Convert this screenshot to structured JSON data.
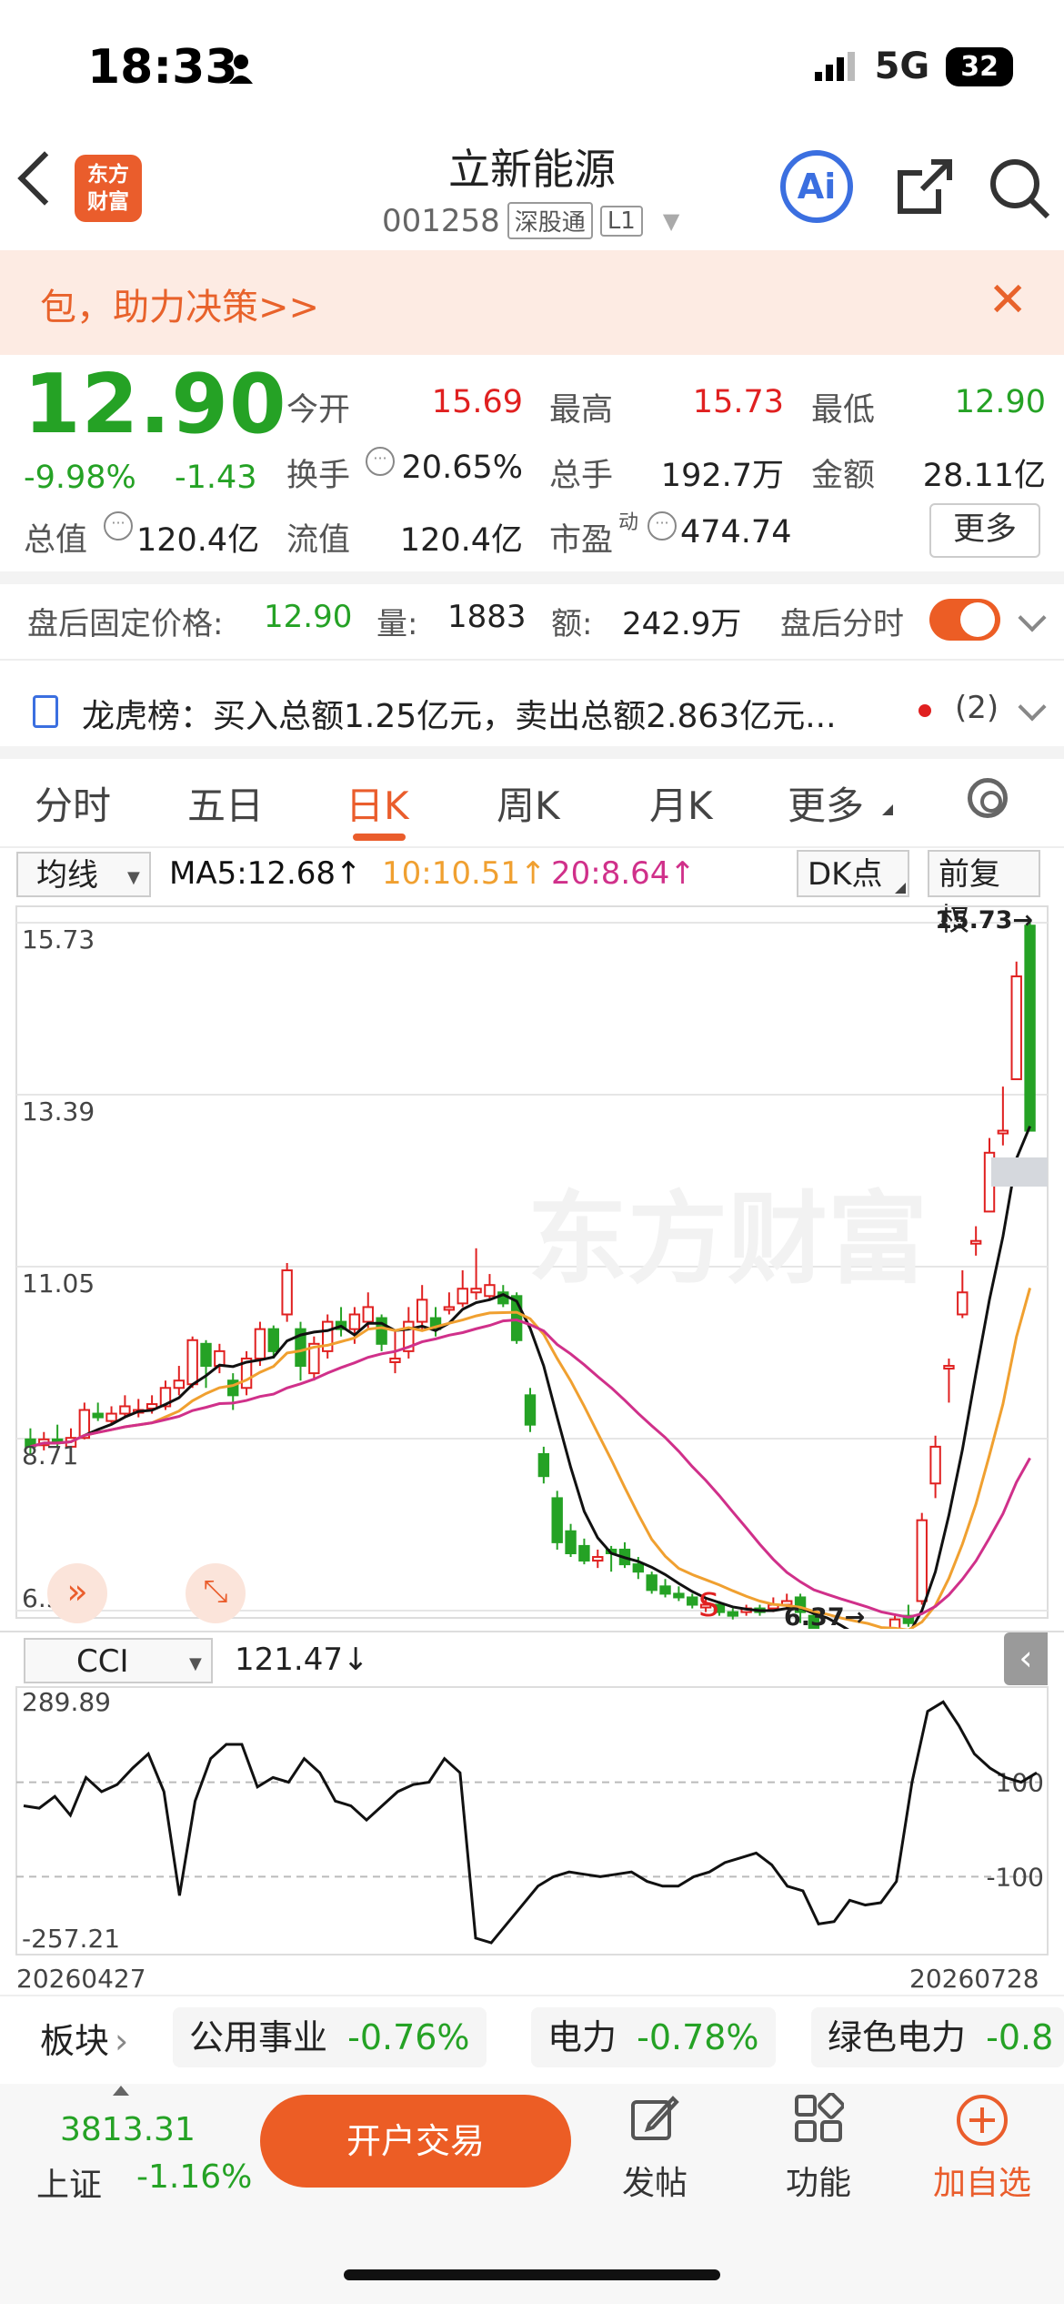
{
  "status_bar": {
    "time": "18:33",
    "network": "5G",
    "battery": "32"
  },
  "header": {
    "title": "立新能源",
    "code": "001258",
    "tag1": "深股通",
    "tag2": "L1",
    "logo_line1": "东方",
    "logo_line2": "财富",
    "ai_label": "Ai"
  },
  "banner": {
    "text": "包，助力决策>>"
  },
  "quote": {
    "price": "12.90",
    "change_pct": "-9.98%",
    "change": "-1.43",
    "open_label": "今开",
    "open": "15.69",
    "high_label": "最高",
    "high": "15.73",
    "low_label": "最低",
    "low": "12.90",
    "turnover_label": "换手",
    "turnover": "20.65%",
    "volume_label": "总手",
    "volume": "192.7万",
    "amount_label": "金额",
    "amount": "28.11亿",
    "mktcap_label": "总值",
    "mktcap": "120.4亿",
    "float_label": "流值",
    "float_cap": "120.4亿",
    "pe_label": "市盈",
    "pe_sup": "动",
    "pe": "474.74",
    "more": "更多"
  },
  "after_hours": {
    "label": "盘后固定价格:",
    "price": "12.90",
    "vol_label": "量:",
    "vol": "1883",
    "amt_label": "额:",
    "amt": "242.9万",
    "timeshare": "盘后分时"
  },
  "dragon_tiger": {
    "text": "龙虎榜：买入总额1.25亿元，卖出总额2.863亿元...",
    "count": "(2)"
  },
  "tabs": [
    "分时",
    "五日",
    "日K",
    "周K",
    "月K",
    "更多"
  ],
  "chart_controls": {
    "ma_select": "均线",
    "ma5": "MA5:12.68↑",
    "ma10": "10:10.51↑",
    "ma20": "20:8.64↑",
    "dk": "DK点",
    "adjust": "前复权"
  },
  "indicator": {
    "name": "CCI",
    "value": "121.47↓"
  },
  "colors": {
    "up": "#e02020",
    "down": "#25a225",
    "accent": "#ea5d2c",
    "ma5": "#111111",
    "ma10": "#f0a030",
    "ma20": "#d0308a"
  },
  "chart_data": {
    "type": "candlestick",
    "y_ticks": [
      "15.73",
      "13.39",
      "11.05",
      "8.71",
      "6.37"
    ],
    "ylim": [
      6.37,
      15.73
    ],
    "annotations": {
      "max_label": "15.73→",
      "min_label": "6.37→",
      "marker": "S"
    },
    "x_start": "20260427",
    "x_end": "20260728",
    "candles": [
      [
        8.7,
        8.6,
        8.85,
        8.5
      ],
      [
        8.62,
        8.7,
        8.8,
        8.55
      ],
      [
        8.7,
        8.65,
        8.9,
        8.6
      ],
      [
        8.6,
        8.72,
        8.85,
        8.55
      ],
      [
        8.72,
        9.1,
        9.2,
        8.7
      ],
      [
        9.05,
        9.0,
        9.2,
        8.95
      ],
      [
        8.95,
        9.05,
        9.15,
        8.9
      ],
      [
        9.05,
        9.15,
        9.3,
        9.0
      ],
      [
        9.1,
        9.1,
        9.25,
        9.0
      ],
      [
        9.12,
        9.18,
        9.3,
        9.05
      ],
      [
        9.15,
        9.4,
        9.5,
        9.1
      ],
      [
        9.4,
        9.5,
        9.7,
        9.3
      ],
      [
        9.45,
        10.05,
        10.1,
        9.4
      ],
      [
        10.0,
        9.7,
        10.05,
        9.4
      ],
      [
        9.7,
        9.9,
        10.0,
        9.6
      ],
      [
        9.5,
        9.3,
        9.6,
        9.1
      ],
      [
        9.4,
        9.8,
        9.9,
        9.3
      ],
      [
        9.8,
        10.2,
        10.3,
        9.7
      ],
      [
        10.2,
        9.9,
        10.25,
        9.8
      ],
      [
        10.4,
        11.0,
        11.1,
        10.3
      ],
      [
        10.2,
        9.7,
        10.3,
        9.5
      ],
      [
        9.6,
        10.0,
        10.1,
        9.5
      ],
      [
        9.9,
        10.3,
        10.4,
        9.8
      ],
      [
        10.3,
        10.2,
        10.5,
        10.1
      ],
      [
        10.2,
        10.4,
        10.5,
        10.0
      ],
      [
        10.3,
        10.5,
        10.7,
        10.2
      ],
      [
        10.35,
        10.0,
        10.4,
        9.9
      ],
      [
        9.75,
        9.8,
        10.2,
        9.6
      ],
      [
        9.9,
        10.3,
        10.5,
        9.8
      ],
      [
        10.3,
        10.6,
        10.8,
        10.2
      ],
      [
        10.35,
        10.2,
        10.5,
        10.1
      ],
      [
        10.5,
        10.5,
        10.7,
        10.4
      ],
      [
        10.55,
        10.75,
        11.0,
        10.5
      ],
      [
        10.7,
        10.75,
        11.3,
        10.6
      ],
      [
        10.65,
        10.8,
        10.95,
        10.6
      ],
      [
        10.7,
        10.55,
        10.8,
        10.5
      ],
      [
        10.65,
        10.05,
        10.7,
        10.0
      ],
      [
        9.3,
        8.9,
        9.4,
        8.8
      ],
      [
        8.5,
        8.2,
        8.6,
        8.1
      ],
      [
        7.9,
        7.3,
        8.0,
        7.2
      ],
      [
        7.45,
        7.15,
        7.55,
        7.1
      ],
      [
        7.25,
        7.05,
        7.35,
        7.0
      ],
      [
        7.05,
        7.1,
        7.2,
        6.95
      ],
      [
        7.2,
        7.15,
        7.25,
        6.9
      ],
      [
        7.2,
        7.0,
        7.3,
        6.95
      ],
      [
        7.0,
        6.9,
        7.1,
        6.8
      ],
      [
        6.85,
        6.65,
        6.9,
        6.6
      ],
      [
        6.7,
        6.6,
        6.8,
        6.55
      ],
      [
        6.6,
        6.55,
        6.7,
        6.5
      ],
      [
        6.55,
        6.45,
        6.6,
        6.4
      ],
      [
        6.45,
        6.45,
        6.55,
        6.35
      ],
      [
        6.45,
        6.35,
        6.5,
        6.3
      ],
      [
        6.35,
        6.3,
        6.4,
        6.25
      ],
      [
        6.35,
        6.4,
        6.45,
        6.3
      ],
      [
        6.4,
        6.35,
        6.45,
        6.3
      ],
      [
        6.4,
        6.45,
        6.55,
        6.35
      ],
      [
        6.45,
        6.5,
        6.6,
        6.4
      ],
      [
        6.55,
        6.35,
        6.6,
        6.2
      ],
      [
        6.3,
        6.0,
        6.35,
        5.95
      ],
      [
        6.05,
        6.05,
        6.1,
        5.95
      ],
      [
        6.0,
        5.95,
        6.05,
        5.9
      ],
      [
        6.0,
        5.95,
        6.1,
        5.9
      ],
      [
        5.95,
        5.95,
        6.0,
        5.85
      ],
      [
        5.9,
        5.85,
        5.95,
        5.75
      ],
      [
        6.1,
        6.25,
        6.3,
        6.05
      ],
      [
        6.3,
        6.2,
        6.45,
        6.15
      ],
      [
        6.5,
        7.6,
        7.7,
        6.45
      ],
      [
        8.1,
        8.6,
        8.75,
        7.9
      ],
      [
        9.7,
        9.7,
        9.8,
        9.2
      ],
      [
        10.4,
        10.7,
        11.0,
        10.35
      ],
      [
        11.4,
        11.4,
        11.6,
        11.2
      ],
      [
        11.8,
        12.6,
        12.8,
        11.8
      ],
      [
        12.9,
        12.9,
        13.5,
        12.7
      ],
      [
        13.6,
        15.0,
        15.2,
        13.6
      ],
      [
        15.69,
        12.9,
        15.73,
        12.9
      ]
    ],
    "cci": {
      "ylim": [
        -257.21,
        289.89
      ],
      "y_ticks": [
        "289.89",
        "-257.21"
      ],
      "ref_lines": [
        "100",
        "-100"
      ],
      "values": [
        50,
        45,
        70,
        30,
        110,
        80,
        95,
        130,
        160,
        80,
        -140,
        60,
        150,
        180,
        180,
        90,
        110,
        100,
        150,
        120,
        60,
        50,
        20,
        50,
        80,
        95,
        100,
        150,
        120,
        -230,
        -240,
        -200,
        -160,
        -120,
        -100,
        -90,
        -95,
        -100,
        -95,
        -90,
        -110,
        -120,
        -120,
        -100,
        -90,
        -70,
        -60,
        -50,
        -75,
        -120,
        -130,
        -200,
        -195,
        -150,
        -160,
        -155,
        -110,
        100,
        250,
        270,
        220,
        160,
        130,
        110,
        100,
        120
      ]
    }
  },
  "sectors": {
    "label": "板块",
    "items": [
      {
        "name": "公用事业",
        "change": "-0.76%"
      },
      {
        "name": "电力",
        "change": "-0.78%"
      },
      {
        "name": "绿色电力",
        "change": "-0.8"
      }
    ]
  },
  "bottom_bar": {
    "index_value": "3813.31",
    "index_name": "上证",
    "index_change": "-1.16%",
    "trade_button": "开户交易",
    "post": "发帖",
    "func": "功能",
    "watch": "加自选"
  }
}
